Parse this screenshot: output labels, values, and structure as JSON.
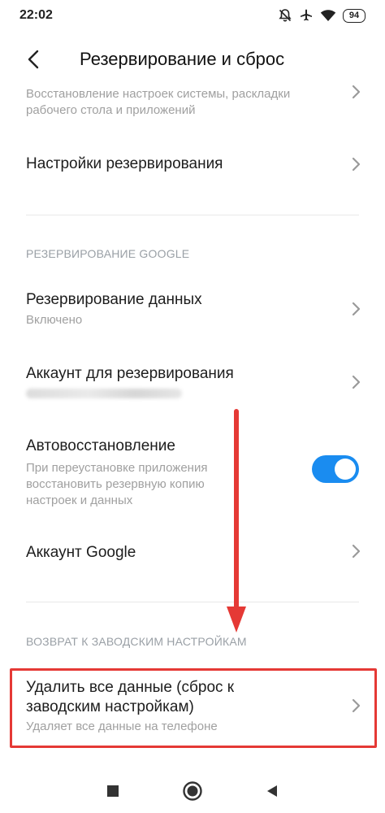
{
  "status": {
    "time": "22:02",
    "battery": "94",
    "icons": [
      "muted-bell-icon",
      "airplane-icon",
      "wifi-icon",
      "battery-icon"
    ]
  },
  "header": {
    "title": "Резервирование и сброс",
    "back_icon": "back-arrow-icon"
  },
  "rows": {
    "restore_partial_sub": "Восстановление настроек системы, раскладки рабочего стола и приложений",
    "backup_settings": {
      "title": "Настройки резервирования"
    },
    "google_section": "РЕЗЕРВИРОВАНИЕ GOOGLE",
    "data_backup": {
      "title": "Резервирование данных",
      "sub": "Включено"
    },
    "backup_account": {
      "title": "Аккаунт для резервирования"
    },
    "auto_restore": {
      "title": "Автовосстановление",
      "sub": "При переустановке приложения восстановить резервную копию настроек и данных",
      "enabled": true
    },
    "google_account": {
      "title": "Аккаунт Google"
    },
    "factory_section": "ВОЗВРАТ К ЗАВОДСКИМ НАСТРОЙКАМ",
    "factory_reset": {
      "title": "Удалить все данные (сброс к заводским настройкам)",
      "sub": "Удаляет все данные на телефоне"
    }
  },
  "colors": {
    "toggle_on": "#1a8cf0",
    "annotation_red": "#e53935"
  },
  "nav": {
    "icons": [
      "recents-square-icon",
      "home-circle-icon",
      "back-triangle-icon"
    ]
  }
}
